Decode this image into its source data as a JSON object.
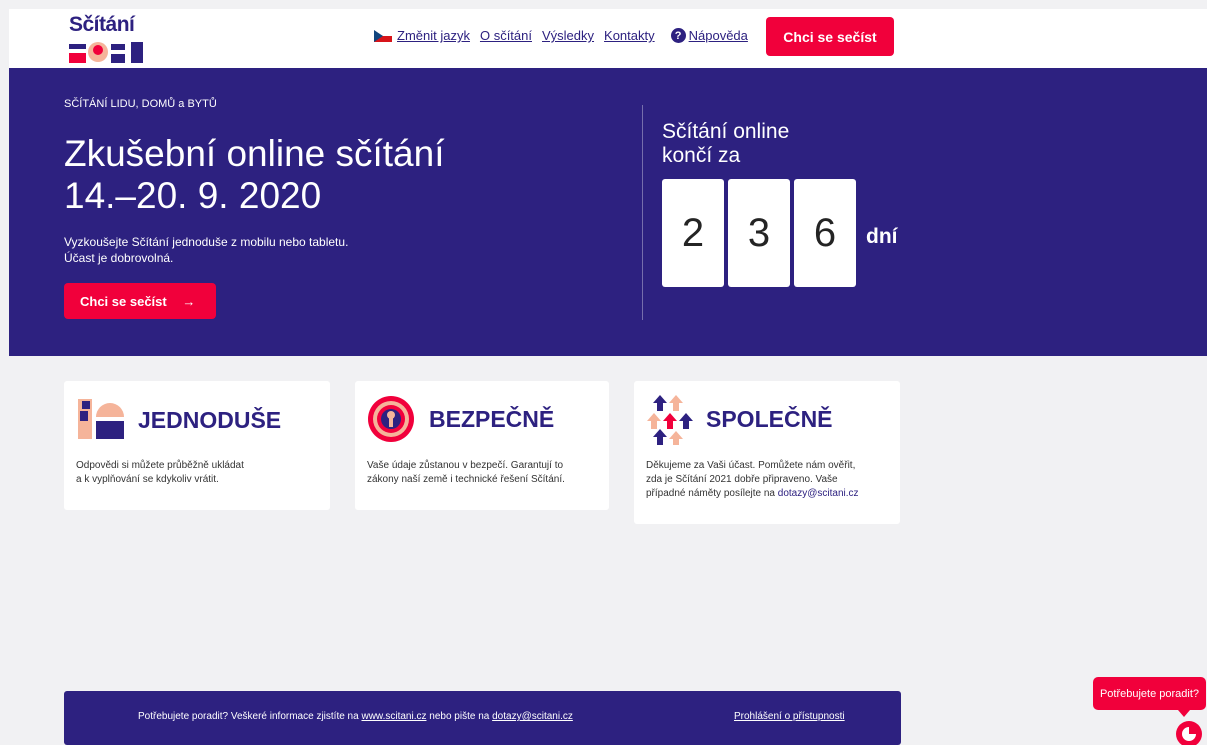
{
  "header": {
    "logo_text": "Sčítání",
    "nav": {
      "language": "Změnit jazyk",
      "about": "O sčítání",
      "results": "Výsledky",
      "contacts": "Kontakty",
      "help": "Nápověda"
    },
    "cta": "Chci se sečíst"
  },
  "hero": {
    "eyebrow": "SČÍTÁNÍ LIDU, DOMŮ a BYTŮ",
    "title_line1": "Zkušební online sčítání",
    "title_line2": "14.–20. 9. 2020",
    "desc_line1": "Vyzkoušejte Sčítání jednoduše z mobilu nebo tabletu.",
    "desc_line2": "Účast je dobrovolná.",
    "cta": "Chci se sečíst",
    "cta_arrow": "→"
  },
  "countdown": {
    "title_line1": "Sčítání online",
    "title_line2": "končí za",
    "digits": [
      "2",
      "3",
      "6"
    ],
    "unit": "dní"
  },
  "cards": [
    {
      "title": "JEDNODUŠE",
      "text_line1": "Odpovědi si můžete průběžně ukládat",
      "text_line2": "a k vyplňování se kdykoliv vrátit."
    },
    {
      "title": "BEZPEČNĚ",
      "text_line1": "Vaše údaje zůstanou v bezpečí. Garantují to",
      "text_line2": "zákony naší země i technické řešení Sčítání."
    },
    {
      "title": "SPOLEČNĚ",
      "text_line1": "Děkujeme za Vaši účast. Pomůžete nám ověřit,",
      "text_line2": "zda je Sčítání 2021 dobře připraveno. Vaše",
      "text_line3": "případné náměty posílejte na",
      "email": "dotazy@scitani.cz"
    }
  ],
  "footer": {
    "text_before": "Potřebujete poradit? Veškeré informace zjistíte na",
    "site_link": "www.scitani.cz",
    "text_middle": "nebo pište na",
    "email_link": "dotazy@scitani.cz",
    "accessibility": "Prohlášení o přístupnosti"
  },
  "help_widget": {
    "label": "Potřebujete poradit?"
  },
  "colors": {
    "brand_blue": "#2d2180",
    "brand_red": "#f1003b",
    "peach": "#f5b49a"
  }
}
